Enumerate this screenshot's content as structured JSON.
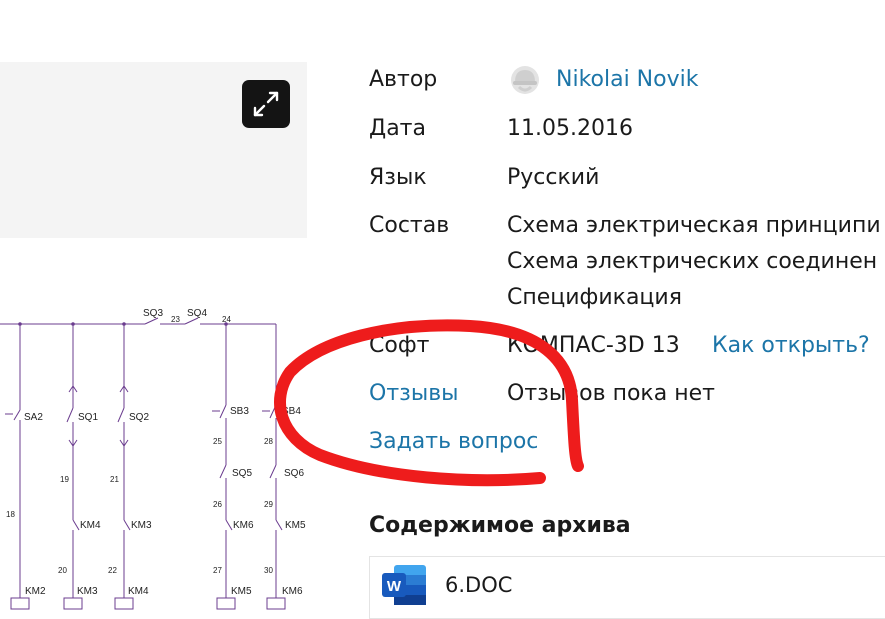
{
  "meta": {
    "author_label": "Автор",
    "author_name": "Nikolai Novik",
    "date_label": "Дата",
    "date_value": "11.05.2016",
    "language_label": "Язык",
    "language_value": "Русский",
    "contents_label": "Состав",
    "contents_items": [
      "Схема электрическая принципи",
      "Схема электрических соединен",
      "Спецификация"
    ],
    "soft_label": "Софт",
    "soft_value": "КОМПАС-3D 13",
    "how_to_open": "Как открыть?",
    "reviews_label": "Отзывы",
    "reviews_value": "Отзывов пока нет",
    "ask_question": "Задать вопрос"
  },
  "archive": {
    "title": "Содержимое архива",
    "files": [
      {
        "name": "6.DOC",
        "icon": "word-doc-icon"
      }
    ]
  },
  "schematic": {
    "labels": [
      "SQ3",
      "23",
      "SQ4",
      "24",
      "SA2",
      "SQ1",
      "SQ2",
      "SB3",
      "SB4",
      "25",
      "28",
      "SQ5",
      "SQ6",
      "19",
      "21",
      "26",
      "29",
      "18",
      "KM4",
      "KM3",
      "KM6",
      "KM5",
      "20",
      "22",
      "27",
      "30",
      "KM2",
      "KM3",
      "KM4",
      "KM5",
      "KM6"
    ]
  },
  "colors": {
    "link": "#1c75a8",
    "annotation": "#ee1c1c",
    "word_blue": "#185abd"
  }
}
